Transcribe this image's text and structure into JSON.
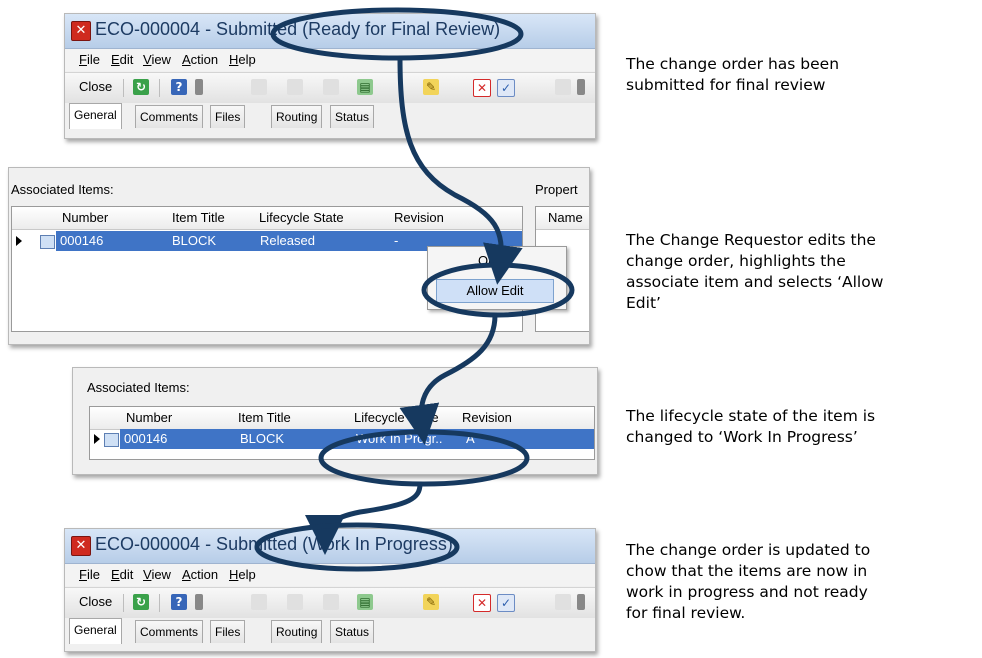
{
  "window_top": {
    "title_prefix": "ECO-000004 - Submitte",
    "title_state": "d (Ready for Final Review)",
    "menu": [
      "File",
      "Edit",
      "View",
      "Action",
      "Help"
    ],
    "toolbar_close": "Close",
    "tabs": [
      "General",
      "Comments",
      "Files",
      "Routing",
      "Status"
    ]
  },
  "grid_one": {
    "label": "Associated Items:",
    "side_label": "Propert",
    "side_header": "Name",
    "columns": [
      "Number",
      "Item Title",
      "Lifecycle State",
      "Revision"
    ],
    "row": {
      "number": "000146",
      "title": "BLOCK",
      "state": "Released",
      "revision": "-"
    },
    "context_menu": [
      "Ope",
      "Allow Edit"
    ]
  },
  "grid_two": {
    "label": "Associated Items:",
    "columns": [
      "Number",
      "Item Title",
      "Lifecycle State",
      "Revision"
    ],
    "row": {
      "number": "000146",
      "title": "BLOCK",
      "state": "Work In Progr..",
      "revision": "A"
    }
  },
  "window_bottom": {
    "title_prefix": "ECO-000004 - Submit",
    "title_state": "ted (Work In Progress)",
    "menu": [
      "File",
      "Edit",
      "View",
      "Action",
      "Help"
    ],
    "toolbar_close": "Close",
    "tabs": [
      "General",
      "Comments",
      "Files",
      "Routing",
      "Status"
    ]
  },
  "descriptions": [
    [
      "The change order has been",
      "submitted for final review"
    ],
    [
      "The Change Requestor edits the",
      "change order, highlights the",
      "associate item and selects ‘Allow",
      "Edit’"
    ],
    [
      "The lifecycle state of the item is",
      "changed to ‘Work In Progress’"
    ],
    [
      "The change order is updated to",
      "chow that the items are now in",
      "work in progress and not ready",
      "for final review."
    ]
  ],
  "colors": {
    "highlight_ellipse": "#16395f",
    "selection_row": "#3f74c6",
    "title_icon": "#cf2a1f"
  }
}
